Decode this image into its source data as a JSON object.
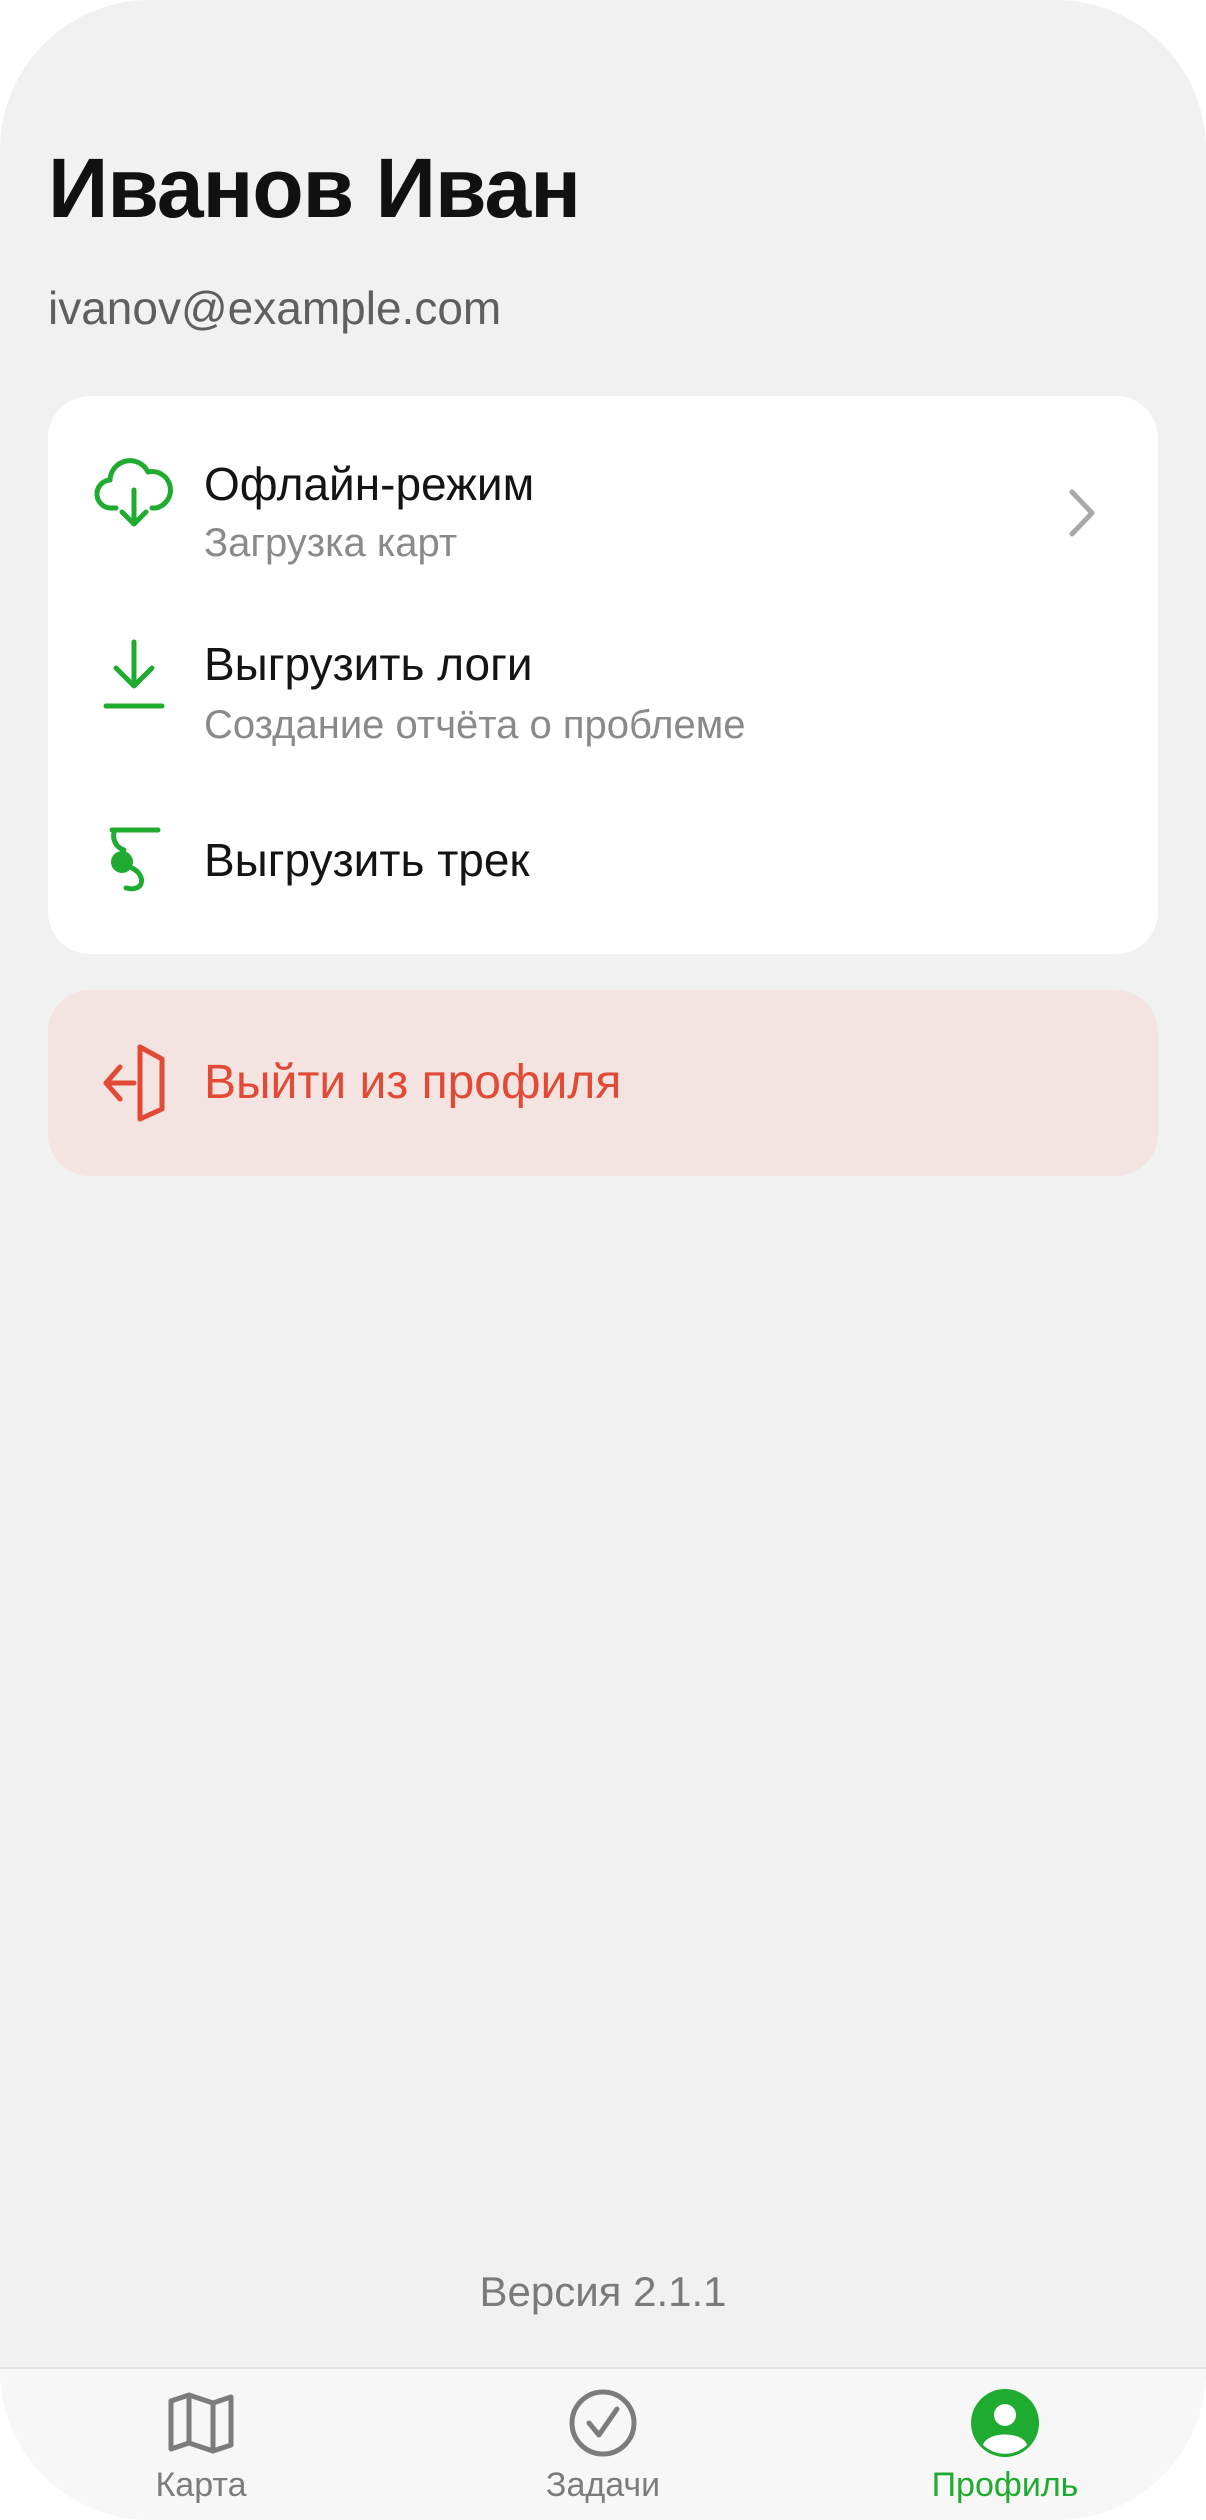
{
  "profile": {
    "name": "Иванов Иван",
    "email": "ivanov@example.com"
  },
  "menu": {
    "items": [
      {
        "title": "Офлайн-режим",
        "subtitle": "Загрузка карт",
        "icon": "cloud-download-icon",
        "has_chevron": true
      },
      {
        "title": "Выгрузить логи",
        "subtitle": "Создание отчёта о проблеме",
        "icon": "download-icon",
        "has_chevron": false
      },
      {
        "title": "Выгрузить трек",
        "subtitle": "",
        "icon": "track-icon",
        "has_chevron": false
      }
    ]
  },
  "logout": {
    "label": "Выйти из профиля",
    "icon": "logout-icon"
  },
  "version": "Версия 2.1.1",
  "tabbar": {
    "tabs": [
      {
        "label": "Карта",
        "icon": "map-icon",
        "active": false
      },
      {
        "label": "Задачи",
        "icon": "check-circle-icon",
        "active": false
      },
      {
        "label": "Профиль",
        "icon": "user-icon",
        "active": true
      }
    ]
  },
  "colors": {
    "accent_green": "#1eab2f",
    "danger_red": "#e24a35",
    "danger_bg": "#f3e3e1",
    "background": "#f1f1f1"
  }
}
